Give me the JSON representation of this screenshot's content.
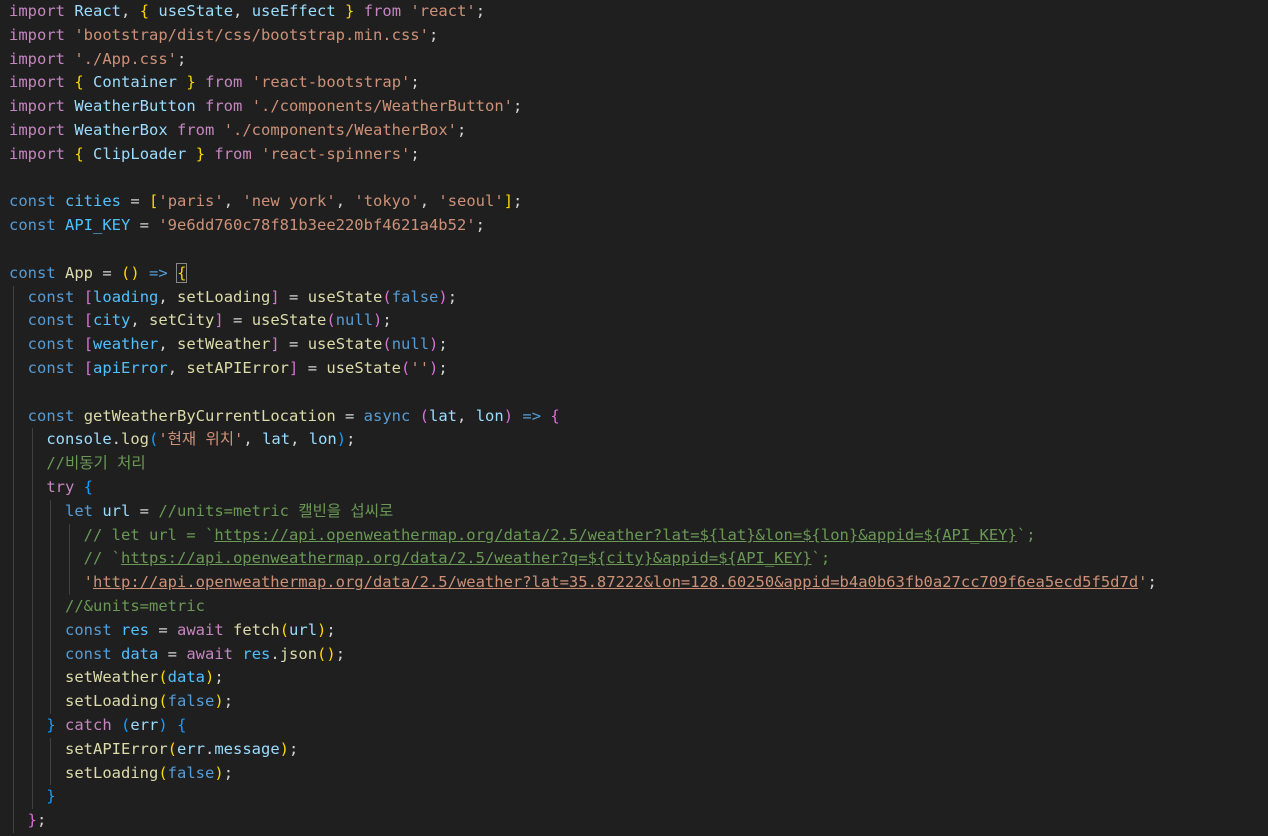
{
  "editor": {
    "theme": "dark",
    "colors": {
      "background": "#1f1f1f",
      "keyword": "#569cd6",
      "control": "#c586c0",
      "variable": "#9cdcfe",
      "constant": "#4fc1ff",
      "function": "#dcdcaa",
      "string": "#ce9178",
      "comment": "#6a9955",
      "punctuation": "#d4d4d4"
    },
    "lines": [
      [
        [
          "import",
          "ctl"
        ],
        [
          " ",
          "p"
        ],
        [
          "React",
          "var"
        ],
        [
          ", ",
          "p"
        ],
        [
          "{",
          "b1"
        ],
        [
          " ",
          "p"
        ],
        [
          "useState",
          "var"
        ],
        [
          ", ",
          "p"
        ],
        [
          "useEffect",
          "var"
        ],
        [
          " ",
          "p"
        ],
        [
          "}",
          "b1"
        ],
        [
          " ",
          "p"
        ],
        [
          "from",
          "ctl"
        ],
        [
          " ",
          "p"
        ],
        [
          "'react'",
          "str"
        ],
        [
          ";",
          "p"
        ]
      ],
      [
        [
          "import",
          "ctl"
        ],
        [
          " ",
          "p"
        ],
        [
          "'bootstrap/dist/css/bootstrap.min.css'",
          "str"
        ],
        [
          ";",
          "p"
        ]
      ],
      [
        [
          "import",
          "ctl"
        ],
        [
          " ",
          "p"
        ],
        [
          "'./App.css'",
          "str"
        ],
        [
          ";",
          "p"
        ]
      ],
      [
        [
          "import",
          "ctl"
        ],
        [
          " ",
          "p"
        ],
        [
          "{",
          "b1"
        ],
        [
          " ",
          "p"
        ],
        [
          "Container",
          "var"
        ],
        [
          " ",
          "p"
        ],
        [
          "}",
          "b1"
        ],
        [
          " ",
          "p"
        ],
        [
          "from",
          "ctl"
        ],
        [
          " ",
          "p"
        ],
        [
          "'react-bootstrap'",
          "str"
        ],
        [
          ";",
          "p"
        ]
      ],
      [
        [
          "import",
          "ctl"
        ],
        [
          " ",
          "p"
        ],
        [
          "WeatherButton",
          "var"
        ],
        [
          " ",
          "p"
        ],
        [
          "from",
          "ctl"
        ],
        [
          " ",
          "p"
        ],
        [
          "'./components/WeatherButton'",
          "str"
        ],
        [
          ";",
          "p"
        ]
      ],
      [
        [
          "import",
          "ctl"
        ],
        [
          " ",
          "p"
        ],
        [
          "WeatherBox",
          "var"
        ],
        [
          " ",
          "p"
        ],
        [
          "from",
          "ctl"
        ],
        [
          " ",
          "p"
        ],
        [
          "'./components/WeatherBox'",
          "str"
        ],
        [
          ";",
          "p"
        ]
      ],
      [
        [
          "import",
          "ctl"
        ],
        [
          " ",
          "p"
        ],
        [
          "{",
          "b1"
        ],
        [
          " ",
          "p"
        ],
        [
          "ClipLoader",
          "var"
        ],
        [
          " ",
          "p"
        ],
        [
          "}",
          "b1"
        ],
        [
          " ",
          "p"
        ],
        [
          "from",
          "ctl"
        ],
        [
          " ",
          "p"
        ],
        [
          "'react-spinners'",
          "str"
        ],
        [
          ";",
          "p"
        ]
      ],
      [],
      [
        [
          "const",
          "kw"
        ],
        [
          " ",
          "p"
        ],
        [
          "cities",
          "cst"
        ],
        [
          " = ",
          "p"
        ],
        [
          "[",
          "b1"
        ],
        [
          "'paris'",
          "str"
        ],
        [
          ", ",
          "p"
        ],
        [
          "'new york'",
          "str"
        ],
        [
          ", ",
          "p"
        ],
        [
          "'tokyo'",
          "str"
        ],
        [
          ", ",
          "p"
        ],
        [
          "'seoul'",
          "str"
        ],
        [
          "]",
          "b1"
        ],
        [
          ";",
          "p"
        ]
      ],
      [
        [
          "const",
          "kw"
        ],
        [
          " ",
          "p"
        ],
        [
          "API_KEY",
          "cst"
        ],
        [
          " = ",
          "p"
        ],
        [
          "'9e6dd760c78f81b3ee220bf4621a4b52'",
          "str"
        ],
        [
          ";",
          "p"
        ]
      ],
      [],
      [
        [
          "const",
          "kw"
        ],
        [
          " ",
          "p"
        ],
        [
          "App",
          "fn"
        ],
        [
          " = ",
          "p"
        ],
        [
          "(",
          "b1"
        ],
        [
          ")",
          "b1"
        ],
        [
          " ",
          "p"
        ],
        [
          "=>",
          "kw"
        ],
        [
          " ",
          "p"
        ],
        [
          "{",
          "b1 bm"
        ]
      ],
      [
        [
          "  ",
          "p"
        ],
        [
          "const",
          "kw"
        ],
        [
          " ",
          "p"
        ],
        [
          "[",
          "b2"
        ],
        [
          "loading",
          "cst"
        ],
        [
          ", ",
          "p"
        ],
        [
          "setLoading",
          "fn"
        ],
        [
          "]",
          "b2"
        ],
        [
          " = ",
          "p"
        ],
        [
          "useState",
          "fn"
        ],
        [
          "(",
          "b2"
        ],
        [
          "false",
          "kw"
        ],
        [
          ")",
          "b2"
        ],
        [
          ";",
          "p"
        ]
      ],
      [
        [
          "  ",
          "p"
        ],
        [
          "const",
          "kw"
        ],
        [
          " ",
          "p"
        ],
        [
          "[",
          "b2"
        ],
        [
          "city",
          "cst"
        ],
        [
          ", ",
          "p"
        ],
        [
          "setCity",
          "fn"
        ],
        [
          "]",
          "b2"
        ],
        [
          " = ",
          "p"
        ],
        [
          "useState",
          "fn"
        ],
        [
          "(",
          "b2"
        ],
        [
          "null",
          "kw"
        ],
        [
          ")",
          "b2"
        ],
        [
          ";",
          "p"
        ]
      ],
      [
        [
          "  ",
          "p"
        ],
        [
          "const",
          "kw"
        ],
        [
          " ",
          "p"
        ],
        [
          "[",
          "b2"
        ],
        [
          "weather",
          "cst"
        ],
        [
          ", ",
          "p"
        ],
        [
          "setWeather",
          "fn"
        ],
        [
          "]",
          "b2"
        ],
        [
          " = ",
          "p"
        ],
        [
          "useState",
          "fn"
        ],
        [
          "(",
          "b2"
        ],
        [
          "null",
          "kw"
        ],
        [
          ")",
          "b2"
        ],
        [
          ";",
          "p"
        ]
      ],
      [
        [
          "  ",
          "p"
        ],
        [
          "const",
          "kw"
        ],
        [
          " ",
          "p"
        ],
        [
          "[",
          "b2"
        ],
        [
          "apiError",
          "cst"
        ],
        [
          ", ",
          "p"
        ],
        [
          "setAPIError",
          "fn"
        ],
        [
          "]",
          "b2"
        ],
        [
          " = ",
          "p"
        ],
        [
          "useState",
          "fn"
        ],
        [
          "(",
          "b2"
        ],
        [
          "''",
          "str"
        ],
        [
          ")",
          "b2"
        ],
        [
          ";",
          "p"
        ]
      ],
      [],
      [
        [
          "  ",
          "p"
        ],
        [
          "const",
          "kw"
        ],
        [
          " ",
          "p"
        ],
        [
          "getWeatherByCurrentLocation",
          "fn"
        ],
        [
          " = ",
          "p"
        ],
        [
          "async",
          "kw"
        ],
        [
          " ",
          "p"
        ],
        [
          "(",
          "b2"
        ],
        [
          "lat",
          "var"
        ],
        [
          ", ",
          "p"
        ],
        [
          "lon",
          "var"
        ],
        [
          ")",
          "b2"
        ],
        [
          " ",
          "p"
        ],
        [
          "=>",
          "kw"
        ],
        [
          " ",
          "p"
        ],
        [
          "{",
          "b2"
        ]
      ],
      [
        [
          "    ",
          "p"
        ],
        [
          "console",
          "var"
        ],
        [
          ".",
          "p"
        ],
        [
          "log",
          "fn"
        ],
        [
          "(",
          "b3"
        ],
        [
          "'현재 위치'",
          "str"
        ],
        [
          ", ",
          "p"
        ],
        [
          "lat",
          "var"
        ],
        [
          ", ",
          "p"
        ],
        [
          "lon",
          "var"
        ],
        [
          ")",
          "b3"
        ],
        [
          ";",
          "p"
        ]
      ],
      [
        [
          "    ",
          "p"
        ],
        [
          "//비동기 처리",
          "cmt"
        ]
      ],
      [
        [
          "    ",
          "p"
        ],
        [
          "try",
          "ctl"
        ],
        [
          " ",
          "p"
        ],
        [
          "{",
          "b3"
        ]
      ],
      [
        [
          "      ",
          "p"
        ],
        [
          "let",
          "kw"
        ],
        [
          " ",
          "p"
        ],
        [
          "url",
          "var"
        ],
        [
          " = ",
          "p"
        ],
        [
          "//units=metric 캘빈을 섭씨로",
          "cmt"
        ]
      ],
      [
        [
          "        ",
          "p"
        ],
        [
          "// let url = `",
          "cmt"
        ],
        [
          "https://api.openweathermap.org/data/2.5/weather?lat=${lat}&lon=${lon}&appid=${API_KEY}",
          "cmt u"
        ],
        [
          "`;",
          "cmt"
        ]
      ],
      [
        [
          "        ",
          "p"
        ],
        [
          "// `",
          "cmt"
        ],
        [
          "https://api.openweathermap.org/data/2.5/weather?q=${city}&appid=${API_KEY}",
          "cmt u"
        ],
        [
          "`;",
          "cmt"
        ]
      ],
      [
        [
          "        ",
          "p"
        ],
        [
          "'",
          "str"
        ],
        [
          "http://api.openweathermap.org/data/2.5/weather?lat=35.87222&lon=128.60250&appid=b4a0b63fb0a27cc709f6ea5ecd5f5d7d",
          "str u"
        ],
        [
          "'",
          "str"
        ],
        [
          ";",
          "p"
        ]
      ],
      [
        [
          "      ",
          "p"
        ],
        [
          "//&units=metric",
          "cmt"
        ]
      ],
      [
        [
          "      ",
          "p"
        ],
        [
          "const",
          "kw"
        ],
        [
          " ",
          "p"
        ],
        [
          "res",
          "cst"
        ],
        [
          " = ",
          "p"
        ],
        [
          "await",
          "ctl"
        ],
        [
          " ",
          "p"
        ],
        [
          "fetch",
          "fn"
        ],
        [
          "(",
          "b1"
        ],
        [
          "url",
          "var"
        ],
        [
          ")",
          "b1"
        ],
        [
          ";",
          "p"
        ]
      ],
      [
        [
          "      ",
          "p"
        ],
        [
          "const",
          "kw"
        ],
        [
          " ",
          "p"
        ],
        [
          "data",
          "cst"
        ],
        [
          " = ",
          "p"
        ],
        [
          "await",
          "ctl"
        ],
        [
          " ",
          "p"
        ],
        [
          "res",
          "cst"
        ],
        [
          ".",
          "p"
        ],
        [
          "json",
          "fn"
        ],
        [
          "(",
          "b1"
        ],
        [
          ")",
          "b1"
        ],
        [
          ";",
          "p"
        ]
      ],
      [
        [
          "      ",
          "p"
        ],
        [
          "setWeather",
          "fn"
        ],
        [
          "(",
          "b1"
        ],
        [
          "data",
          "cst"
        ],
        [
          ")",
          "b1"
        ],
        [
          ";",
          "p"
        ]
      ],
      [
        [
          "      ",
          "p"
        ],
        [
          "setLoading",
          "fn"
        ],
        [
          "(",
          "b1"
        ],
        [
          "false",
          "kw"
        ],
        [
          ")",
          "b1"
        ],
        [
          ";",
          "p"
        ]
      ],
      [
        [
          "    ",
          "p"
        ],
        [
          "}",
          "b3"
        ],
        [
          " ",
          "p"
        ],
        [
          "catch",
          "ctl"
        ],
        [
          " ",
          "p"
        ],
        [
          "(",
          "b3"
        ],
        [
          "err",
          "var"
        ],
        [
          ")",
          "b3"
        ],
        [
          " ",
          "p"
        ],
        [
          "{",
          "b3"
        ]
      ],
      [
        [
          "      ",
          "p"
        ],
        [
          "setAPIError",
          "fn"
        ],
        [
          "(",
          "b1"
        ],
        [
          "err",
          "var"
        ],
        [
          ".",
          "p"
        ],
        [
          "message",
          "var"
        ],
        [
          ")",
          "b1"
        ],
        [
          ";",
          "p"
        ]
      ],
      [
        [
          "      ",
          "p"
        ],
        [
          "setLoading",
          "fn"
        ],
        [
          "(",
          "b1"
        ],
        [
          "false",
          "kw"
        ],
        [
          ")",
          "b1"
        ],
        [
          ";",
          "p"
        ]
      ],
      [
        [
          "    ",
          "p"
        ],
        [
          "}",
          "b3"
        ]
      ],
      [
        [
          "  ",
          "p"
        ],
        [
          "}",
          "b2"
        ],
        [
          ";",
          "p"
        ]
      ]
    ]
  }
}
